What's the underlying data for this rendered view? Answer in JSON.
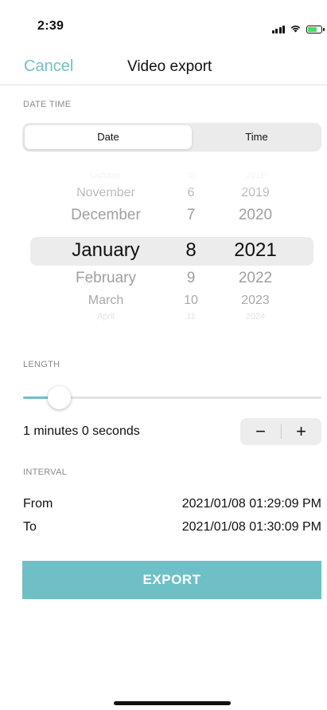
{
  "status_bar": {
    "time": "2:39",
    "icons": [
      "cellular-signal-icon",
      "wifi-icon",
      "battery-charging-icon"
    ]
  },
  "nav": {
    "cancel_label": "Cancel",
    "title": "Video export"
  },
  "date_time": {
    "section_label": "DATE TIME",
    "tabs": [
      {
        "label": "Date",
        "selected": true
      },
      {
        "label": "Time",
        "selected": false
      }
    ]
  },
  "picker": {
    "months": [
      "October",
      "November",
      "December",
      "January",
      "February",
      "March",
      "April"
    ],
    "days": [
      "5",
      "6",
      "7",
      "8",
      "9",
      "10",
      "11"
    ],
    "years": [
      "2018",
      "2019",
      "2020",
      "2021",
      "2022",
      "2023",
      "2024"
    ],
    "selected": {
      "month": "January",
      "day": "8",
      "year": "2021"
    }
  },
  "length": {
    "section_label": "LENGTH",
    "slider_fraction": 0.12,
    "value_text": "1 minutes 0 seconds",
    "minus_label": "−",
    "plus_label": "+"
  },
  "interval": {
    "section_label": "INTERVAL",
    "from_label": "From",
    "from_value": "2021/01/08 01:29:09 PM",
    "to_label": "To",
    "to_value": "2021/01/08 01:30:09 PM"
  },
  "export_label": "EXPORT",
  "colors": {
    "accent": "#6dc2c8",
    "export_button": "#6ec0c6"
  }
}
